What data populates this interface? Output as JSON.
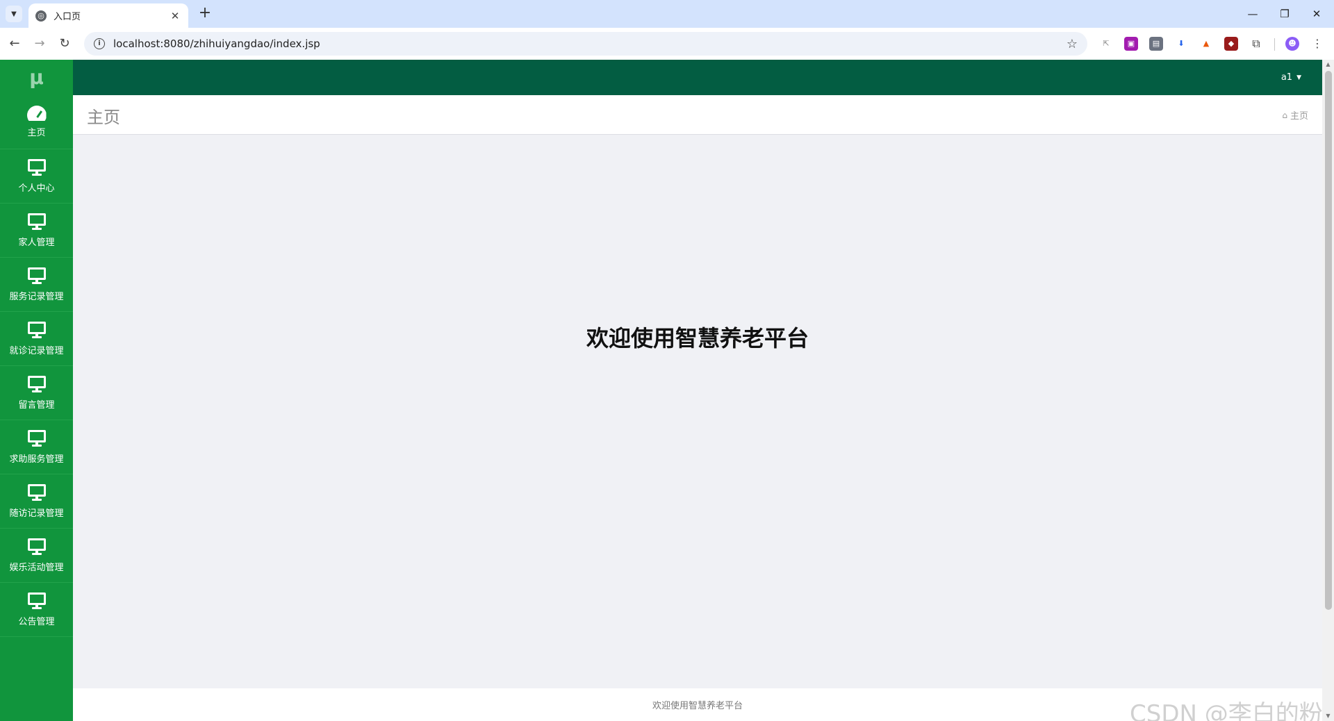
{
  "browser": {
    "tab_title": "入口页",
    "url": "localhost:8080/zhihuiyangdao/index.jsp"
  },
  "app": {
    "brand": "μ",
    "user": "a1",
    "page_title": "主页",
    "breadcrumb": "主页",
    "welcome": "欢迎使用智慧养老平台",
    "footer": "欢迎使用智慧养老平台"
  },
  "sidebar": {
    "items": [
      {
        "label": "主页",
        "icon": "dashboard-icon"
      },
      {
        "label": "个人中心",
        "icon": "monitor-icon"
      },
      {
        "label": "家人管理",
        "icon": "monitor-icon"
      },
      {
        "label": "服务记录管理",
        "icon": "monitor-icon"
      },
      {
        "label": "就诊记录管理",
        "icon": "monitor-icon"
      },
      {
        "label": "留言管理",
        "icon": "monitor-icon"
      },
      {
        "label": "求助服务管理",
        "icon": "monitor-icon"
      },
      {
        "label": "随访记录管理",
        "icon": "monitor-icon"
      },
      {
        "label": "娱乐活动管理",
        "icon": "monitor-icon"
      },
      {
        "label": "公告管理",
        "icon": "monitor-icon"
      }
    ]
  },
  "watermark": "CSDN @李白的粉",
  "colors": {
    "sidebar": "#11953d",
    "topbar": "#035d42",
    "content_bg": "#f0f1f5"
  }
}
